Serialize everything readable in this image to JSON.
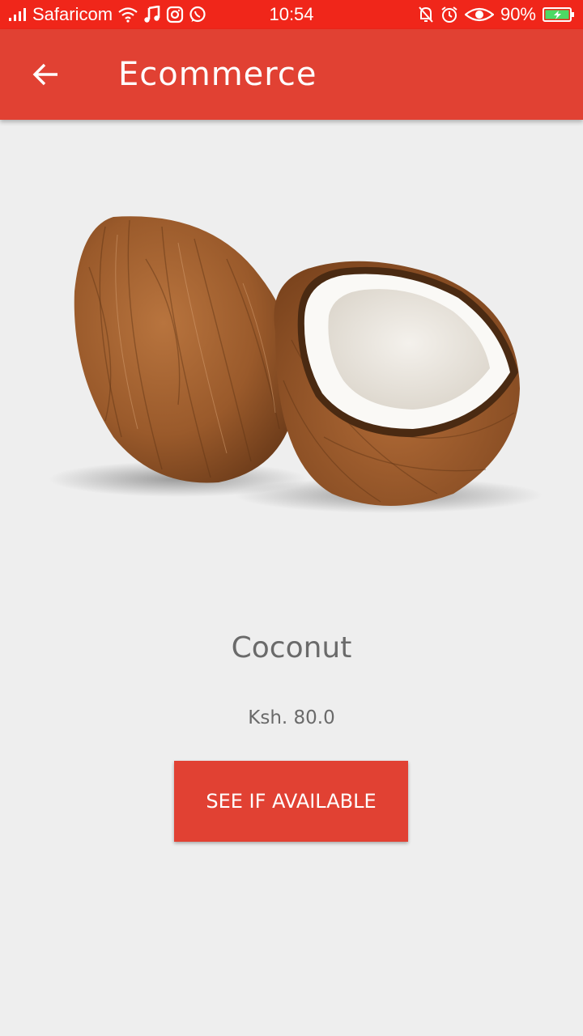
{
  "status_bar": {
    "carrier": "Safaricom",
    "time": "10:54",
    "battery": "90%",
    "icons_left": [
      "signal-icon",
      "wifi-icon",
      "music-icon",
      "instagram-icon",
      "whatsapp-icon"
    ],
    "icons_right": [
      "mute-icon",
      "alarm-icon",
      "eye-icon",
      "battery-icon"
    ]
  },
  "app_bar": {
    "title": "Ecommerce",
    "back_icon": "back-arrow-icon",
    "color": "#e14133"
  },
  "product": {
    "name": "Coconut",
    "price": "Ksh. 80.0",
    "image": "coconut-image"
  },
  "actions": {
    "check_availability_label": "SEE IF AVAILABLE"
  },
  "colors": {
    "status_bar": "#f0261a",
    "accent": "#e14133",
    "background": "#eeeeee",
    "text": "#6a6a6a"
  }
}
